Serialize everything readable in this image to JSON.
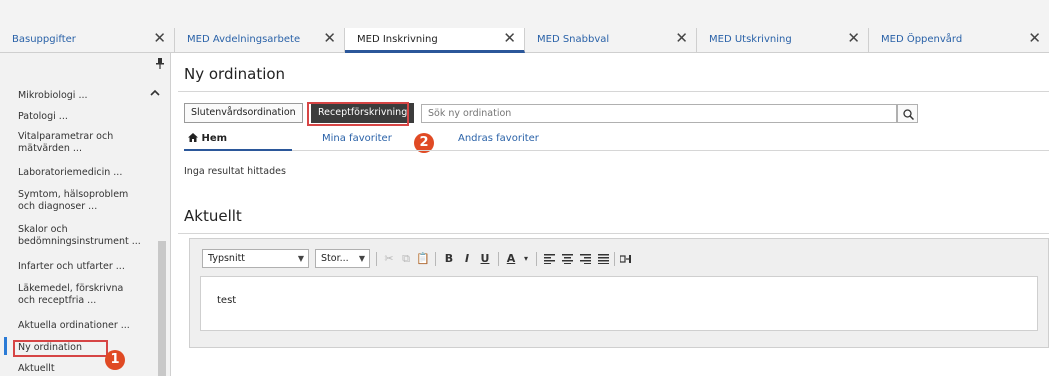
{
  "tabs": [
    {
      "label": "Basuppgifter",
      "close": "✕"
    },
    {
      "label": "MED Avdelningsarbete",
      "close": "✕"
    },
    {
      "label": "MED Inskrivning",
      "close": "✕"
    },
    {
      "label": "MED Snabbval",
      "close": "✕"
    },
    {
      "label": "MED Utskrivning",
      "close": "✕"
    },
    {
      "label": "MED Öppenvård",
      "close": "✕"
    }
  ],
  "sidebar": {
    "items": [
      "Mikrobiologi ...",
      "Patologi ...",
      "Vitalparametrar och mätvärden ...",
      "Laboratoriemedicin ...",
      "Symtom, hälsoproblem och diagnoser ...",
      "Skalor och bedömningsinstrument ...",
      "Infarter och utfarter ...",
      "Läkemedel, förskrivna och receptfria ...",
      "Aktuella ordinationer ...",
      "Ny ordination",
      "Aktuellt"
    ]
  },
  "main": {
    "title": "Ny ordination",
    "buttons": {
      "slutenvard": "Slutenvårdsordination",
      "recept": "Receptförskrivning"
    },
    "search_placeholder": "Sök ny ordination",
    "subtabs": {
      "hem": "Hem",
      "mina": "Mina favoriter",
      "andras": "Andras favoriter"
    },
    "no_results": "Inga resultat hittades",
    "section_title": "Aktuellt"
  },
  "editor": {
    "font_select": "Typsnitt",
    "size_select": "Stor...",
    "content": "test",
    "toolbar": [
      "B",
      "I",
      "U",
      "A"
    ]
  },
  "badges": {
    "one": "1",
    "two": "2"
  },
  "colors": {
    "accent": "#2b579a",
    "link": "#2a62a8",
    "callout": "#e04a24",
    "highlight": "#d64545"
  }
}
